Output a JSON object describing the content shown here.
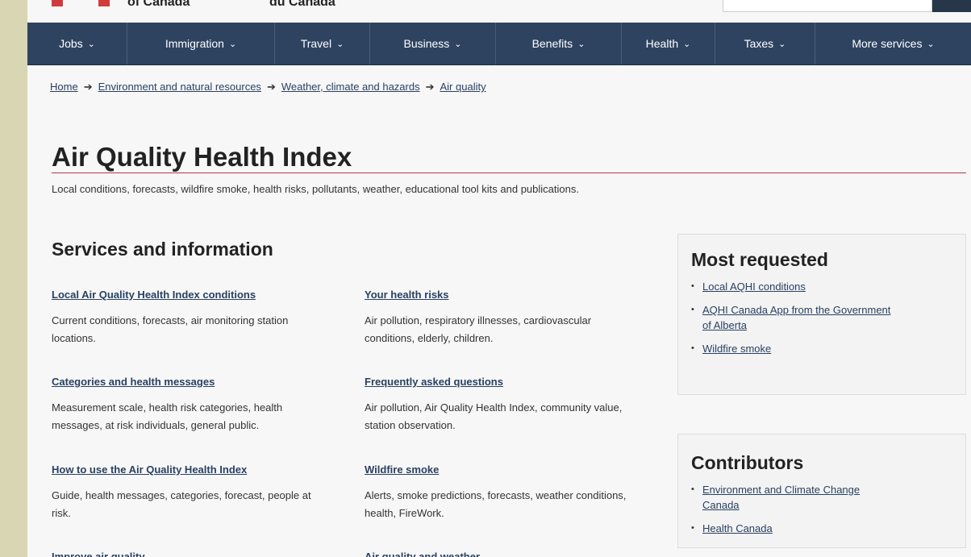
{
  "header": {
    "top_cut_left": "of Canada",
    "top_cut_right": "du Canada"
  },
  "menu": [
    {
      "label": "Jobs",
      "width": 124
    },
    {
      "label": "Immigration",
      "width": 183
    },
    {
      "label": "Travel",
      "width": 118
    },
    {
      "label": "Business",
      "width": 156
    },
    {
      "label": "Benefits",
      "width": 156
    },
    {
      "label": "Health",
      "width": 116
    },
    {
      "label": "Taxes",
      "width": 124
    },
    {
      "label": "More services",
      "width": 193
    }
  ],
  "breadcrumb": [
    "Home",
    "Environment and natural resources",
    "Weather, climate and hazards",
    "Air quality"
  ],
  "page": {
    "title": "Air Quality Health Index",
    "subtitle": "Local conditions, forecasts, wildfire smoke, health risks, pollutants, weather, educational tool kits and publications."
  },
  "services": {
    "heading": "Services and information",
    "items": [
      {
        "title": "Local Air Quality Health Index conditions",
        "desc": "Current conditions, forecasts, air monitoring station locations."
      },
      {
        "title": "Your health risks",
        "desc": "Air pollution, respiratory illnesses, cardiovascular conditions, elderly, children."
      },
      {
        "title": "Categories and health messages",
        "desc": "Measurement scale, health risk categories, health messages, at risk individuals, general public."
      },
      {
        "title": "Frequently asked questions",
        "desc": "Air pollution, Air Quality Health Index, community value, station observation."
      },
      {
        "title": "How to use the Air Quality Health Index",
        "desc": "Guide, health messages, categories, forecast, people at risk."
      },
      {
        "title": "Wildfire smoke",
        "desc": "Alerts, smoke predictions, forecasts, weather conditions, health, FireWork."
      },
      {
        "title": "Improve air quality",
        "desc": ""
      },
      {
        "title": "Air quality and weather",
        "desc": ""
      }
    ]
  },
  "most_requested": {
    "heading": "Most requested",
    "links": [
      "Local AQHI conditions",
      "AQHI Canada App from the Government of Alberta",
      "Wildfire smoke"
    ]
  },
  "contributors": {
    "heading": "Contributors",
    "links": [
      "Environment and Climate Change Canada",
      "Health Canada"
    ]
  },
  "colors": {
    "menu_bg": "#2e4360",
    "link": "#284162",
    "title_rule": "#af3c43",
    "outer_bg": "#d8d6b3"
  }
}
